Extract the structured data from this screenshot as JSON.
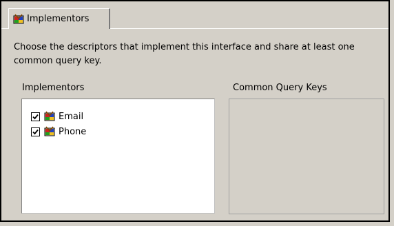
{
  "tab": {
    "label": "Implementors",
    "icon": "descriptor-icon"
  },
  "description": "Choose the descriptors that implement this interface and share at least one common query key.",
  "implementors": {
    "label": "Implementors",
    "items": [
      {
        "label": "Email",
        "checked": true,
        "icon": "descriptor-icon"
      },
      {
        "label": "Phone",
        "checked": true,
        "icon": "descriptor-icon"
      }
    ]
  },
  "query_keys": {
    "label": "Common Query Keys",
    "items": []
  }
}
